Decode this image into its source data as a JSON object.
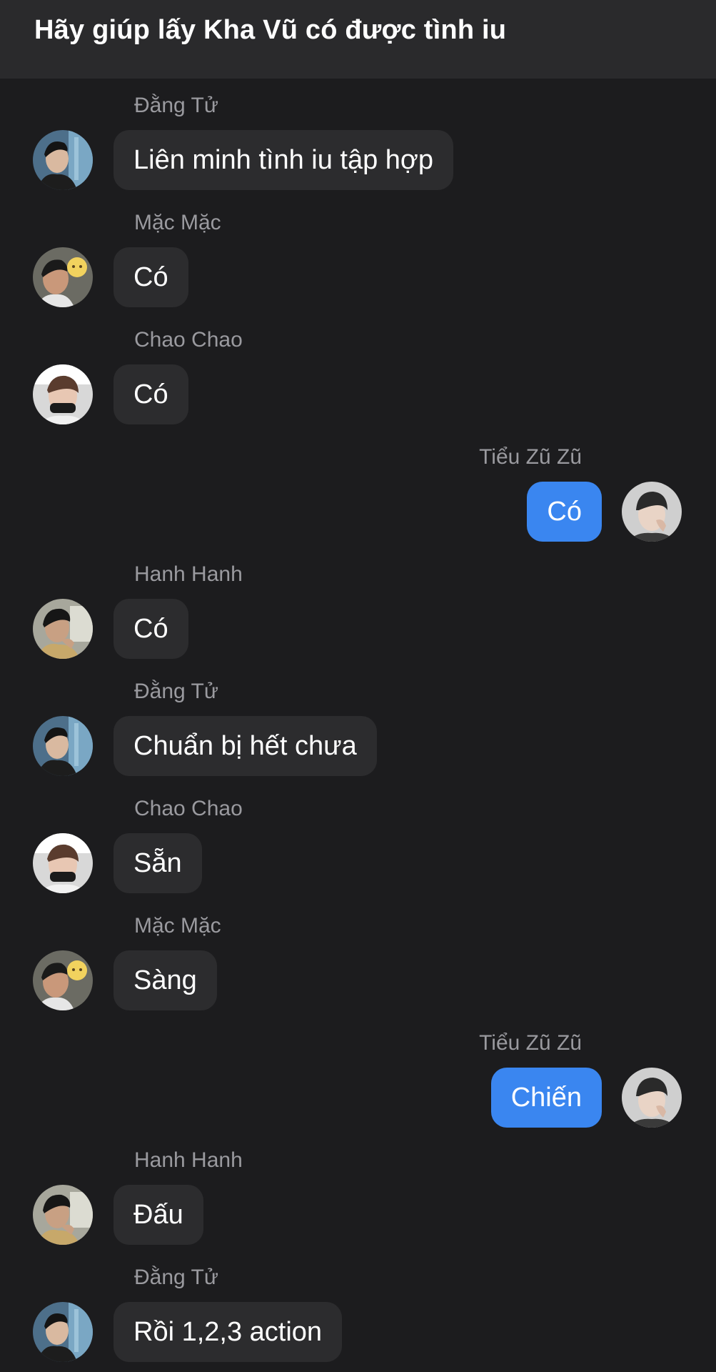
{
  "header": {
    "title": "Hãy giúp lấy Kha Vũ có được tình iu"
  },
  "messages": [
    {
      "sender": "Đằng Tử",
      "text": "Liên minh tình iu tập hợp",
      "side": "in",
      "avatar": "dangtu"
    },
    {
      "sender": "Mặc Mặc",
      "text": "Có",
      "side": "in",
      "avatar": "macmac"
    },
    {
      "sender": "Chao Chao",
      "text": "Có",
      "side": "in",
      "avatar": "chaochao"
    },
    {
      "sender": "Tiểu Zũ Zũ",
      "text": "Có",
      "side": "out",
      "avatar": "tieuzuzu"
    },
    {
      "sender": "Hanh Hanh",
      "text": "Có",
      "side": "in",
      "avatar": "hanhhanh"
    },
    {
      "sender": "Đằng Tử",
      "text": "Chuẩn bị hết chưa",
      "side": "in",
      "avatar": "dangtu"
    },
    {
      "sender": "Chao Chao",
      "text": "Sẵn",
      "side": "in",
      "avatar": "chaochao"
    },
    {
      "sender": "Mặc Mặc",
      "text": "Sàng",
      "side": "in",
      "avatar": "macmac"
    },
    {
      "sender": "Tiểu Zũ Zũ",
      "text": "Chiến",
      "side": "out",
      "avatar": "tieuzuzu"
    },
    {
      "sender": "Hanh Hanh",
      "text": "Đấu",
      "side": "in",
      "avatar": "hanhhanh"
    },
    {
      "sender": "Đằng Tử",
      "text": "Rồi 1,2,3 action",
      "side": "in",
      "avatar": "dangtu"
    }
  ],
  "colors": {
    "background": "#1c1c1e",
    "header": "#2a2a2c",
    "incoming_bubble": "#2c2c2e",
    "outgoing_bubble": "#3a86f0",
    "sender_name": "#9a9a9f"
  }
}
